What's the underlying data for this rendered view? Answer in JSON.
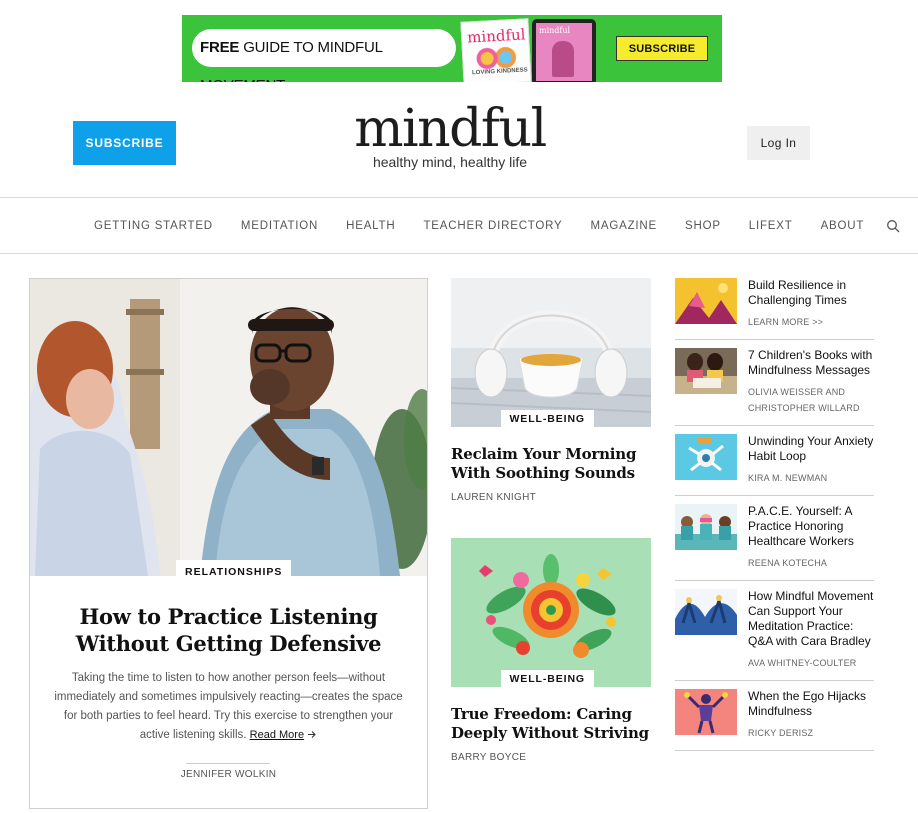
{
  "banner": {
    "free": "FREE",
    "headline": "GUIDE TO MINDFUL MOVEMENT",
    "magazine_title": "mindful",
    "magazine_sub": "LOVING KINDNESS",
    "tablet_title": "mindful",
    "cta": "SUBSCRIBE",
    "bg_color": "#3bc43b",
    "cta_color": "#f7eb2e"
  },
  "header": {
    "subscribe_label": "SUBSCRIBE",
    "logo": "mindful",
    "tagline": "healthy mind, healthy life",
    "login_label": "Log In",
    "accent_color": "#0ea1ea"
  },
  "nav": {
    "items": [
      "GETTING STARTED",
      "MEDITATION",
      "HEALTH",
      "TEACHER DIRECTORY",
      "MAGAZINE",
      "SHOP",
      "LIFEXT",
      "ABOUT"
    ],
    "search_icon": "search-icon"
  },
  "featured": {
    "category": "RELATIONSHIPS",
    "title": "How to Practice Listening Without Getting Defensive",
    "excerpt": "Taking the time to listen to how another person feels—without immediately and sometimes impulsively reacting—creates the space for both parties to feel heard. Try this exercise to strengthen your active listening skills.",
    "read_more": "Read More",
    "read_more_icon": "arrow-right-icon",
    "author": "JENNIFER WOLKIN"
  },
  "middle": [
    {
      "category": "WELL-BEING",
      "title": "Reclaim Your Morning With Soothing Sounds",
      "author": "LAUREN KNIGHT"
    },
    {
      "category": "WELL-BEING",
      "title": "True Freedom: Caring Deeply Without Striving",
      "author": "BARRY BOYCE"
    }
  ],
  "sidebar": [
    {
      "title": "Build Resilience in Challenging Times",
      "byline": "LEARN MORE >>"
    },
    {
      "title": "7 Children's Books with Mindfulness Messages",
      "byline": "OLIVIA WEISSER AND CHRISTOPHER WILLARD"
    },
    {
      "title": "Unwinding Your Anxiety Habit Loop",
      "byline": "KIRA M. NEWMAN"
    },
    {
      "title": "P.A.C.E. Yourself: A Practice Honoring Healthcare Workers",
      "byline": "REENA KOTECHA"
    },
    {
      "title": "How Mindful Movement Can Support Your Meditation Practice: Q&A with Cara Bradley",
      "byline": "AVA WHITNEY-COULTER"
    },
    {
      "title": "When the Ego Hijacks Mindfulness",
      "byline": "RICKY DERISZ"
    }
  ]
}
